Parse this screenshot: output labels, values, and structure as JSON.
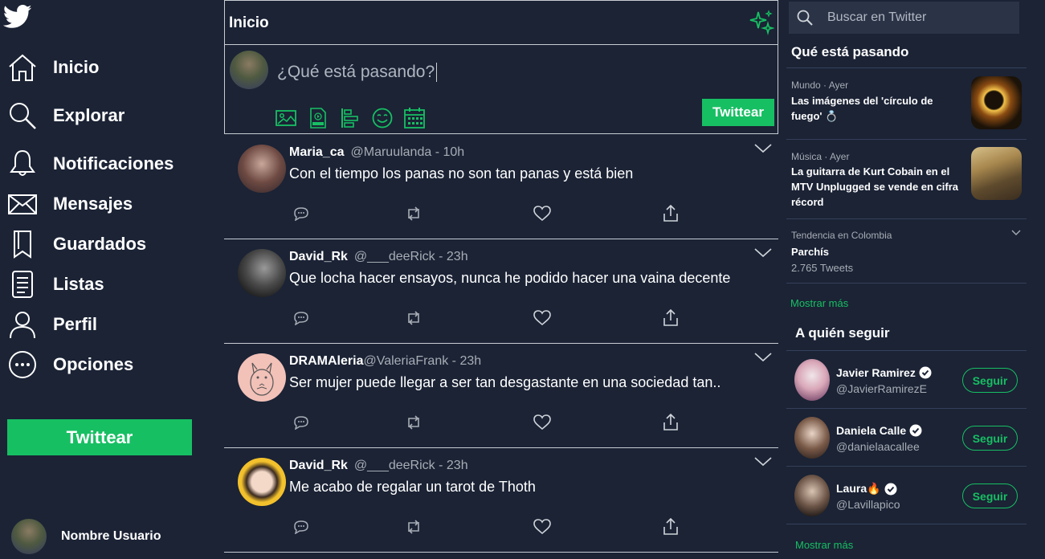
{
  "nav": {
    "items": [
      {
        "label": "Inicio",
        "icon": "home-icon"
      },
      {
        "label": "Explorar",
        "icon": "search-icon"
      },
      {
        "label": "Notificaciones",
        "icon": "bell-icon"
      },
      {
        "label": "Mensajes",
        "icon": "envelope-icon"
      },
      {
        "label": "Guardados",
        "icon": "bookmark-icon"
      },
      {
        "label": "Listas",
        "icon": "list-icon"
      },
      {
        "label": "Perfil",
        "icon": "person-icon"
      },
      {
        "label": "Opciones",
        "icon": "more-icon"
      }
    ],
    "tweet_button": "Twittear",
    "user_name": "Nombre Usuario"
  },
  "header": {
    "title": "Inicio"
  },
  "composer": {
    "placeholder": "¿Qué está pasando?",
    "tweet_button": "Twittear"
  },
  "tweets": [
    {
      "name": "Maria_ca",
      "handle": "@Maruulanda",
      "time": " - 10h",
      "text": "Con el tiempo los panas no son tan panas y está bien"
    },
    {
      "name": "David_Rk",
      "handle": "@___deeRick",
      "time": " - 23h",
      "text": "Que locha hacer ensayos, nunca he podido hacer una vaina decente"
    },
    {
      "name": "DRAMAleria",
      "handle": "@ValeriaFrank",
      "time": " - 23h",
      "text": "Ser mujer puede llegar a ser tan desgastante en una sociedad tan.."
    },
    {
      "name": "David_Rk",
      "handle": "@___deeRick",
      "time": " - 23h",
      "text": "Me acabo de regalar un tarot de Thoth"
    }
  ],
  "search": {
    "placeholder": "Buscar en Twitter"
  },
  "trends": {
    "title": "Qué está pasando",
    "items": [
      {
        "meta": "Mundo · Ayer",
        "title": "Las imágenes del 'círculo de fuego' 💍"
      },
      {
        "meta": "Música · Ayer",
        "title": "La guitarra de Kurt Cobain en el MTV Unplugged se vende en cifra récord"
      },
      {
        "meta": "Tendencia en Colombia",
        "title": "Parchís",
        "count": "2.765 Tweets"
      }
    ],
    "more": "Mostrar más"
  },
  "who_to_follow": {
    "title": "A quién seguir",
    "items": [
      {
        "name": "Javier Ramirez",
        "handle": "@JavierRamirezE",
        "button": "Seguir"
      },
      {
        "name": "Daniela Calle",
        "handle": "@danielaacallee",
        "button": "Seguir"
      },
      {
        "name": "Laura🔥",
        "handle": "@Lavillapico",
        "button": "Seguir"
      }
    ],
    "more": "Mostrar más"
  },
  "colors": {
    "background": "#1b2335",
    "accent": "#17bf63",
    "muted": "#a8adb5"
  }
}
